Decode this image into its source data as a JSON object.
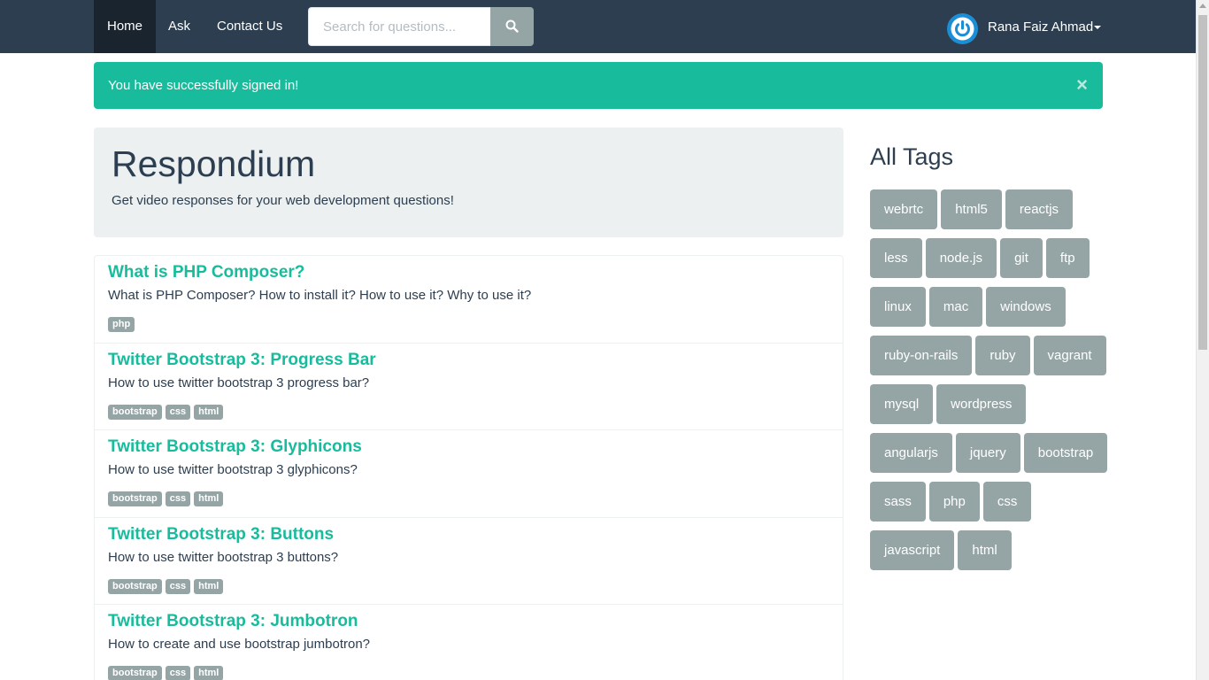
{
  "nav": {
    "items": [
      {
        "label": "Home"
      },
      {
        "label": "Ask"
      },
      {
        "label": "Contact Us"
      }
    ],
    "search_placeholder": "Search for questions...",
    "search_icon": "search-icon",
    "user_name": "Rana Faiz Ahmad"
  },
  "alert": {
    "text": "You have successfully signed in!",
    "close": "×"
  },
  "jumbotron": {
    "title": "Respondium",
    "subtitle": "Get video responses for your web development questions!"
  },
  "questions": [
    {
      "title": "What is PHP Composer?",
      "description": "What is PHP Composer? How to install it? How to use it? Why to use it?",
      "tags": [
        "php"
      ]
    },
    {
      "title": "Twitter Bootstrap 3: Progress Bar",
      "description": "How to use twitter bootstrap 3 progress bar?",
      "tags": [
        "bootstrap",
        "css",
        "html"
      ]
    },
    {
      "title": "Twitter Bootstrap 3: Glyphicons",
      "description": "How to use twitter bootstrap 3 glyphicons?",
      "tags": [
        "bootstrap",
        "css",
        "html"
      ]
    },
    {
      "title": "Twitter Bootstrap 3: Buttons",
      "description": "How to use twitter bootstrap 3 buttons?",
      "tags": [
        "bootstrap",
        "css",
        "html"
      ]
    },
    {
      "title": "Twitter Bootstrap 3: Jumbotron",
      "description": "How to create and use bootstrap jumbotron?",
      "tags": [
        "bootstrap",
        "css",
        "html"
      ]
    }
  ],
  "sidebar": {
    "heading": "All Tags",
    "tags": [
      "webrtc",
      "html5",
      "reactjs",
      "less",
      "node.js",
      "git",
      "ftp",
      "linux",
      "mac",
      "windows",
      "ruby-on-rails",
      "ruby",
      "vagrant",
      "mysql",
      "wordpress",
      "angularjs",
      "jquery",
      "bootstrap",
      "sass",
      "php",
      "css",
      "javascript",
      "html"
    ]
  },
  "colors": {
    "navbar": "#2c3e50",
    "accent": "#18bc9c",
    "tag": "#95a5a6",
    "jumbotron": "#ecf0f1"
  }
}
